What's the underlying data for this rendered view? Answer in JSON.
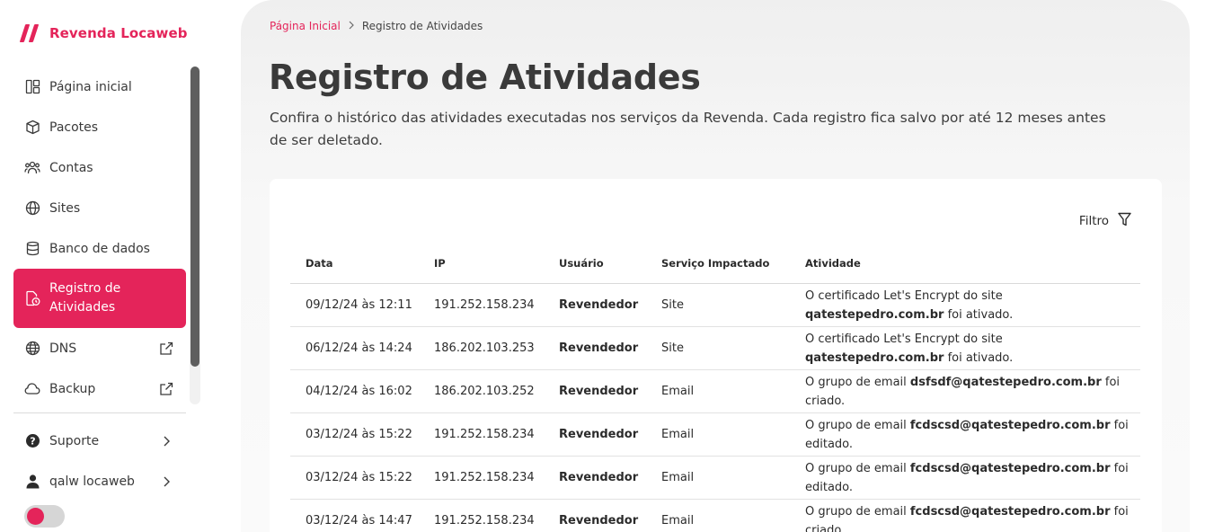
{
  "brand": {
    "name": "Revenda Locaweb",
    "accent_color": "#e4245a"
  },
  "sidebar": {
    "items": [
      {
        "label": "Página inicial",
        "icon": "dashboard-icon",
        "active": false,
        "external": false
      },
      {
        "label": "Pacotes",
        "icon": "box-icon",
        "active": false,
        "external": false
      },
      {
        "label": "Contas",
        "icon": "users-icon",
        "active": false,
        "external": false
      },
      {
        "label": "Sites",
        "icon": "globe-icon",
        "active": false,
        "external": false
      },
      {
        "label": "Banco de dados",
        "icon": "database-icon",
        "active": false,
        "external": false
      },
      {
        "label": "Registro de Atividades",
        "label_line1": "Registro de",
        "label_line2": "Atividades",
        "icon": "activity-log-icon",
        "active": true,
        "external": false
      },
      {
        "label": "DNS",
        "icon": "dns-globe-icon",
        "active": false,
        "external": true
      },
      {
        "label": "Backup",
        "icon": "cloud-icon",
        "active": false,
        "external": true
      }
    ],
    "bottom_items": [
      {
        "label": "Suporte",
        "icon": "help-icon"
      },
      {
        "label": "qalw locaweb",
        "icon": "user-icon"
      }
    ],
    "theme_toggle": {
      "on": false
    }
  },
  "breadcrumb": {
    "home": "Página Inicial",
    "current": "Registro de Atividades"
  },
  "page": {
    "title": "Registro de Atividades",
    "description": "Confira o histórico das atividades executadas nos serviços da Revenda. Cada registro fica salvo por até 12 meses antes de ser deletado."
  },
  "filter": {
    "label": "Filtro"
  },
  "table": {
    "headers": {
      "date": "Data",
      "ip": "IP",
      "user": "Usuário",
      "service": "Serviço Impactado",
      "activity": "Atividade"
    },
    "rows": [
      {
        "date": "09/12/24 às 12:11",
        "ip": "191.252.158.234",
        "user": "Revendedor",
        "service": "Site",
        "act_pre": "O certificado Let's Encrypt do site ",
        "act_bold": "qatestepedro.com.br",
        "act_post": " foi ativado."
      },
      {
        "date": "06/12/24 às 14:24",
        "ip": "186.202.103.253",
        "user": "Revendedor",
        "service": "Site",
        "act_pre": "O certificado Let's Encrypt do site ",
        "act_bold": "qatestepedro.com.br",
        "act_post": " foi ativado."
      },
      {
        "date": "04/12/24 às 16:02",
        "ip": "186.202.103.252",
        "user": "Revendedor",
        "service": "Email",
        "act_pre": "O grupo de email ",
        "act_bold": "dsfsdf@qatestepedro.com.br",
        "act_post": " foi criado."
      },
      {
        "date": "03/12/24 às 15:22",
        "ip": "191.252.158.234",
        "user": "Revendedor",
        "service": "Email",
        "act_pre": "O grupo de email ",
        "act_bold": "fcdscsd@qatestepedro.com.br",
        "act_post": " foi editado."
      },
      {
        "date": "03/12/24 às 15:22",
        "ip": "191.252.158.234",
        "user": "Revendedor",
        "service": "Email",
        "act_pre": "O grupo de email ",
        "act_bold": "fcdscsd@qatestepedro.com.br",
        "act_post": " foi editado."
      },
      {
        "date": "03/12/24 às 14:47",
        "ip": "191.252.158.234",
        "user": "Revendedor",
        "service": "Email",
        "act_pre": "O grupo de email ",
        "act_bold": "fcdscsd@qatestepedro.com.br",
        "act_post": " foi criado."
      }
    ]
  }
}
